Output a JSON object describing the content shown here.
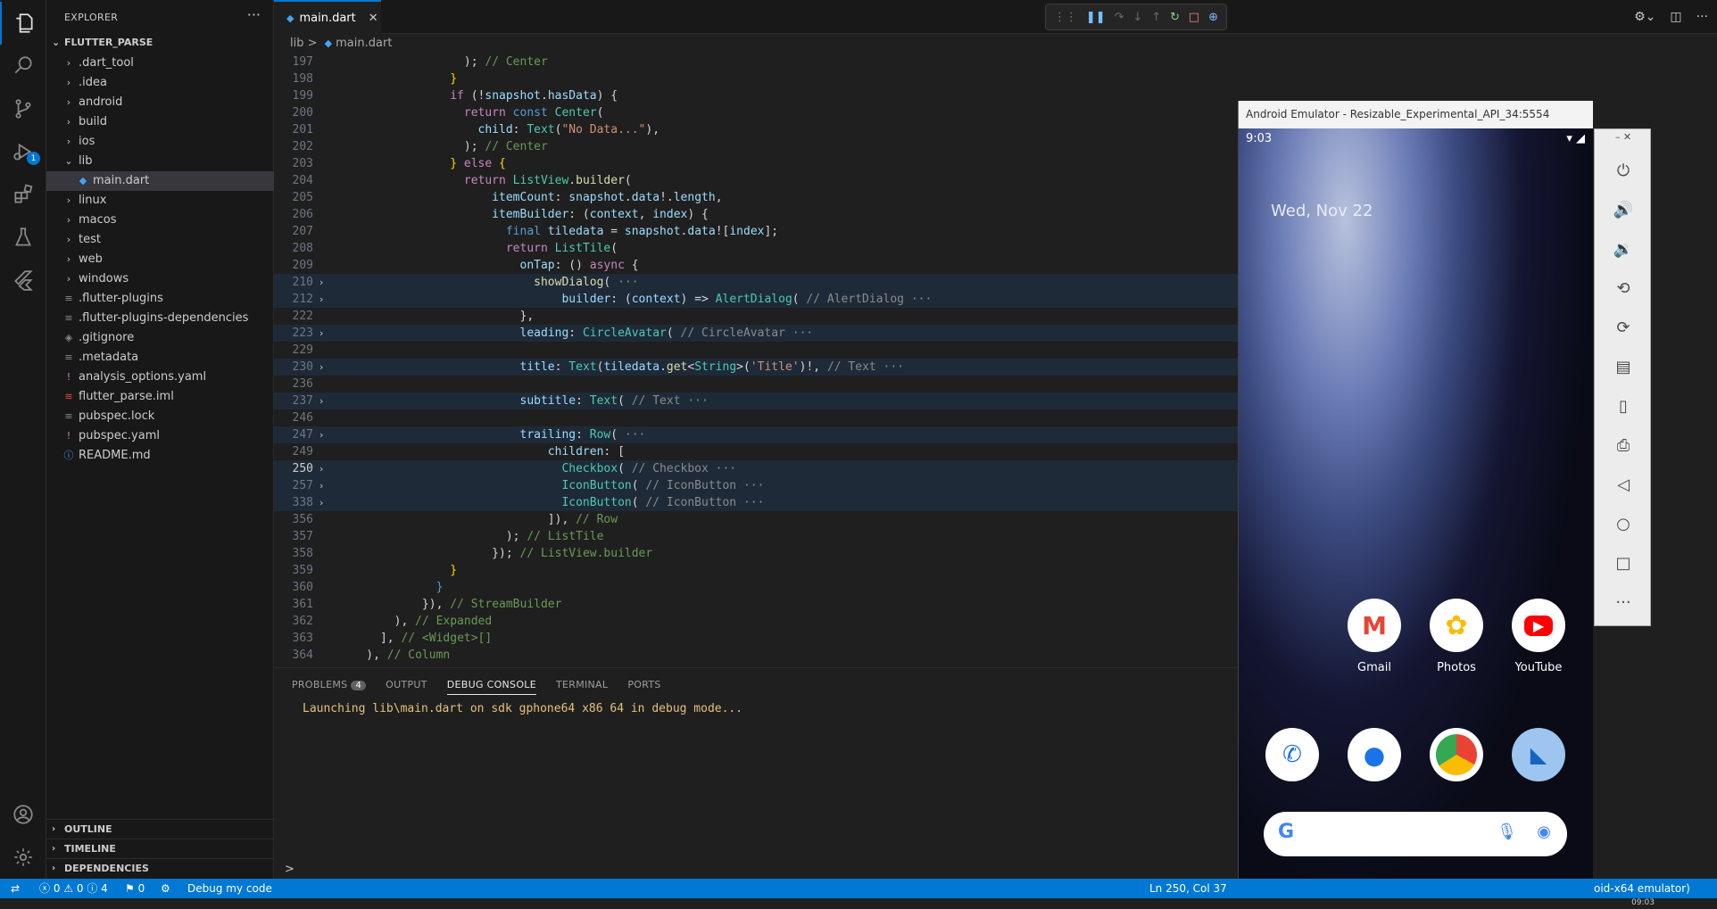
{
  "sidebar": {
    "title": "EXPLORER",
    "more": "···",
    "project": "FLUTTER_PARSE",
    "items": [
      {
        "label": ".dart_tool",
        "type": "folder"
      },
      {
        "label": ".idea",
        "type": "folder"
      },
      {
        "label": "android",
        "type": "folder"
      },
      {
        "label": "build",
        "type": "folder"
      },
      {
        "label": "ios",
        "type": "folder"
      },
      {
        "label": "lib",
        "type": "folder-open"
      },
      {
        "label": "main.dart",
        "type": "dart"
      },
      {
        "label": "linux",
        "type": "folder"
      },
      {
        "label": "macos",
        "type": "folder"
      },
      {
        "label": "test",
        "type": "folder"
      },
      {
        "label": "web",
        "type": "folder"
      },
      {
        "label": "windows",
        "type": "folder"
      },
      {
        "label": ".flutter-plugins",
        "type": "file"
      },
      {
        "label": ".flutter-plugins-dependencies",
        "type": "file"
      },
      {
        "label": ".gitignore",
        "type": "git"
      },
      {
        "label": ".metadata",
        "type": "file"
      },
      {
        "label": "analysis_options.yaml",
        "type": "yaml"
      },
      {
        "label": "flutter_parse.iml",
        "type": "iml"
      },
      {
        "label": "pubspec.lock",
        "type": "file"
      },
      {
        "label": "pubspec.yaml",
        "type": "yaml"
      },
      {
        "label": "README.md",
        "type": "info"
      }
    ],
    "sections": [
      "OUTLINE",
      "TIMELINE",
      "DEPENDENCIES"
    ]
  },
  "activity": {
    "debug_badge": "1"
  },
  "tab": {
    "label": "main.dart",
    "close": "✕"
  },
  "breadcrumb": {
    "folder": "lib",
    "sep": ">",
    "file": "main.dart"
  },
  "editor": {
    "line_numbers": [
      "197",
      "198",
      "199",
      "200",
      "201",
      "202",
      "203",
      "204",
      "205",
      "206",
      "207",
      "208",
      "209",
      "210",
      "212",
      "222",
      "223",
      "229",
      "230",
      "236",
      "237",
      "246",
      "247",
      "249",
      "250",
      "257",
      "338",
      "356",
      "357",
      "358",
      "359",
      "360",
      "361",
      "362",
      "363",
      "364"
    ]
  },
  "panel": {
    "tabs": [
      "PROBLEMS",
      "OUTPUT",
      "DEBUG CONSOLE",
      "TERMINAL",
      "PORTS"
    ],
    "problems_count": "4",
    "output": "Launching lib\\main.dart on sdk gphone64 x86 64 in debug mode...",
    "prompt": ">"
  },
  "statusbar": {
    "errors": "0",
    "warnings": "0",
    "infos": "4",
    "ports": "0",
    "debug_label": "Debug my code",
    "cursor": "Ln 250, Col 37",
    "right_text": "oid-x64 emulator)"
  },
  "emulator": {
    "title": "Android Emulator - Resizable_Experimental_API_34:5554",
    "time": "9:03",
    "date": "Wed, Nov 22",
    "apps_row1": [
      "Gmail",
      "Photos",
      "YouTube"
    ],
    "search_logo": "G"
  },
  "taskbar_time": "09:03",
  "colors": {
    "accent": "#0078d4",
    "status_bar": "#0078d4",
    "editor_bg": "#1f1f1f"
  }
}
